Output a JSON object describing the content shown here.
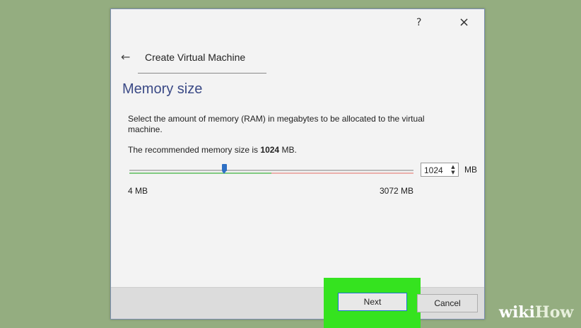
{
  "window": {
    "help_label": "?",
    "close_label": "×"
  },
  "wizard": {
    "back_label": "←",
    "title": "Create Virtual Machine",
    "heading": "Memory size",
    "description": "Select the amount of memory (RAM) in megabytes to be allocated to the virtual machine.",
    "recommended_prefix": "The recommended memory size is ",
    "recommended_value": "1024",
    "recommended_suffix": " MB."
  },
  "memory": {
    "value": "1024",
    "unit": "MB",
    "min_label": "4 MB",
    "max_label": "3072 MB",
    "slider_min": 4,
    "slider_max": 3072,
    "slider_value": 1024,
    "spin_up": "▲",
    "spin_down": "▼"
  },
  "buttons": {
    "next": "Next",
    "cancel": "Cancel"
  },
  "watermark": {
    "part1": "wiki",
    "part2": "How"
  },
  "colors": {
    "background": "#94ad80",
    "highlight": "#35e31f",
    "heading": "#3b4a86",
    "slider_thumb": "#2d6fc4"
  }
}
